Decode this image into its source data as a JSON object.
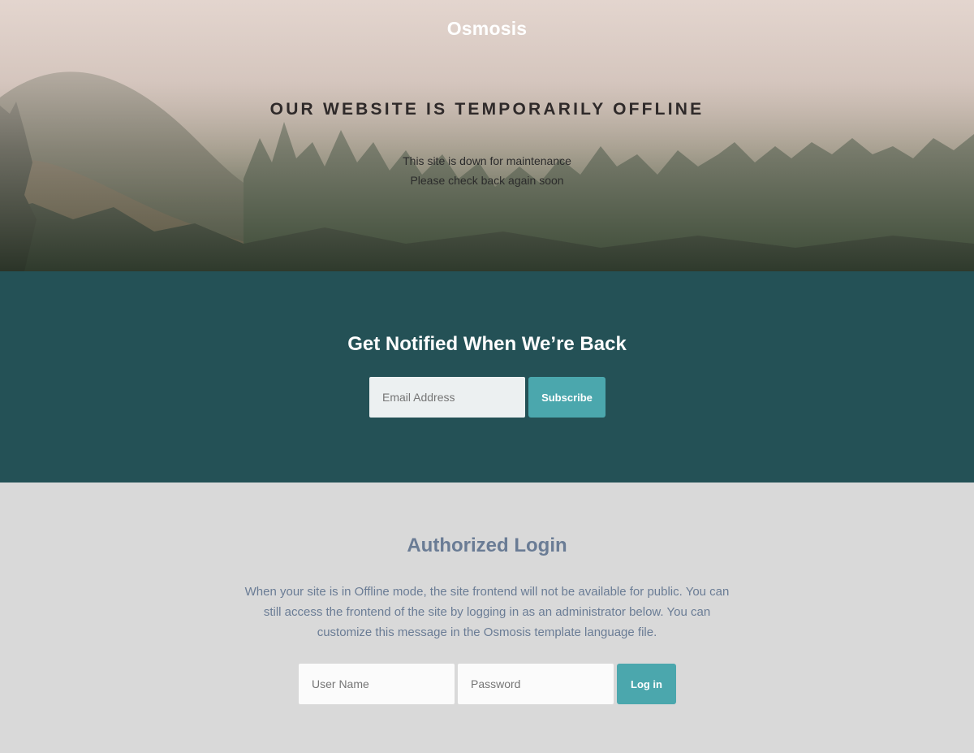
{
  "hero": {
    "brand": "Osmosis",
    "headline": "OUR WEBSITE IS TEMPORARILY OFFLINE",
    "line1": "This site is down for maintenance",
    "line2": "Please check back again soon"
  },
  "notify": {
    "title": "Get Notified When We’re Back",
    "email_placeholder": "Email Address",
    "subscribe_label": "Subscribe"
  },
  "login": {
    "title": "Authorized Login",
    "description": "When your site is in Offline mode, the site frontend will not be available for public. You can still access the frontend of the site by logging in as an administrator below. You can customize this message in the Osmosis template language file.",
    "username_placeholder": "User Name",
    "password_placeholder": "Password",
    "login_label": "Log in"
  },
  "colors": {
    "notify_bg": "#245156",
    "accent": "#4ba7ad",
    "login_bg": "#d9d9d9",
    "login_text": "#6a7c95"
  }
}
